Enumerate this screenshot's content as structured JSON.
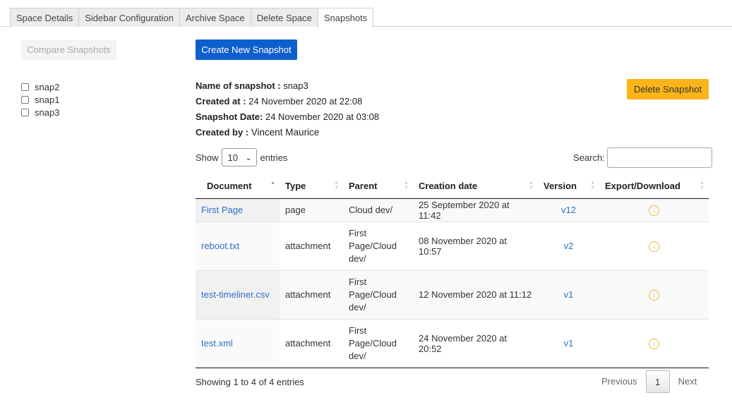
{
  "tabs": [
    {
      "label": "Space Details"
    },
    {
      "label": "Sidebar Configuration"
    },
    {
      "label": "Archive Space"
    },
    {
      "label": "Delete Space"
    },
    {
      "label": "Snapshots",
      "active": true
    }
  ],
  "left": {
    "compare_label": "Compare Snapshots",
    "snapshots": [
      "snap2",
      "snap1",
      "snap3"
    ]
  },
  "actions": {
    "create_label": "Create New Snapshot",
    "delete_label": "Delete Snapshot"
  },
  "snapshot": {
    "name_label": "Name of snapshot :",
    "name": "snap3",
    "created_at_label": "Created at :",
    "created_at": "24 November 2020 at 22:08",
    "date_label": "Snapshot Date:",
    "date": "24 November 2020 at 03:08",
    "created_by_label": "Created by :",
    "created_by": "Vincent Maurice"
  },
  "controls": {
    "show_label": "Show",
    "entries_value": "10",
    "entries_label": "entries",
    "search_label": "Search:"
  },
  "table": {
    "columns": [
      "Document",
      "Type",
      "Parent",
      "Creation date",
      "Version",
      "Export/Download"
    ],
    "rows": [
      {
        "document": "First Page",
        "type": "page",
        "parent": "Cloud dev/",
        "created": "25 September 2020 at 11:42",
        "version": "v12"
      },
      {
        "document": "reboot.txt",
        "type": "attachment",
        "parent": "First Page/Cloud dev/",
        "created": "08 November 2020 at 10:57",
        "version": "v2"
      },
      {
        "document": "test-timeliner.csv",
        "type": "attachment",
        "parent": "First Page/Cloud dev/",
        "created": "12 November 2020 at 11:12",
        "version": "v1"
      },
      {
        "document": "test.xml",
        "type": "attachment",
        "parent": "First Page/Cloud dev/",
        "created": "24 November 2020 at 20:52",
        "version": "v1"
      }
    ]
  },
  "footer": {
    "info": "Showing 1 to 4 of 4 entries",
    "previous": "Previous",
    "page": "1",
    "next": "Next"
  },
  "colors": {
    "primary": "#0d5fce",
    "warning": "#fbb419",
    "link": "#2f6fc9",
    "download_icon": "#e9b93a"
  }
}
